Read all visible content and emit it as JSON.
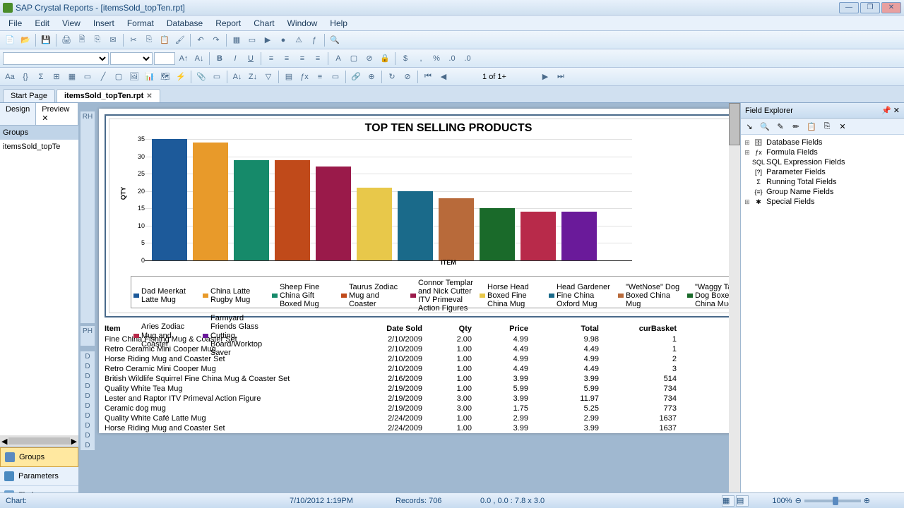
{
  "title": "SAP Crystal Reports - [itemsSold_topTen.rpt]",
  "menu": [
    "File",
    "Edit",
    "View",
    "Insert",
    "Format",
    "Database",
    "Report",
    "Chart",
    "Window",
    "Help"
  ],
  "nav": {
    "page_indicator": "1 of 1+"
  },
  "tabs": {
    "start": "Start Page",
    "doc": "itemsSold_topTen.rpt"
  },
  "subtabs": {
    "design": "Design",
    "preview": "Preview"
  },
  "left": {
    "groups_hdr": "Groups",
    "tree_root": "itemsSold_topTe",
    "btn_groups": "Groups",
    "btn_params": "Parameters",
    "btn_find": "Find"
  },
  "sections": {
    "rh": "RH",
    "ph": "PH",
    "d": "D"
  },
  "right": {
    "title": "Field Explorer",
    "items": [
      "Database Fields",
      "Formula Fields",
      "SQL Expression Fields",
      "Parameter Fields",
      "Running Total Fields",
      "Group Name Fields",
      "Special Fields"
    ]
  },
  "chart_data": {
    "type": "bar",
    "title": "TOP TEN SELLING PRODUCTS",
    "ylabel": "QTY",
    "xlabel": "ITEM",
    "ylim": [
      0,
      35
    ],
    "yticks": [
      0,
      5,
      10,
      15,
      20,
      25,
      30,
      35
    ],
    "series": [
      {
        "name": "Dad Meerkat Latte Mug",
        "value": 35,
        "color": "#1d5a9a"
      },
      {
        "name": "China Latte Rugby Mug",
        "value": 34,
        "color": "#e89a2a"
      },
      {
        "name": "Sheep Fine China Gift Boxed Mug",
        "value": 29,
        "color": "#168a6a"
      },
      {
        "name": "Taurus Zodiac Mug and Coaster",
        "value": 29,
        "color": "#c04a1a"
      },
      {
        "name": "Connor Templar and Nick Cutter ITV Primeval Action Figures",
        "value": 27,
        "color": "#9a1a4a"
      },
      {
        "name": "Horse Head Boxed Fine China Mug",
        "value": 21,
        "color": "#e8c84a"
      },
      {
        "name": "Head Gardener Fine China Oxford Mug",
        "value": 20,
        "color": "#1a6a8a"
      },
      {
        "name": "\"WetNose\" Dog Boxed China Mug",
        "value": 18,
        "color": "#b86a3a"
      },
      {
        "name": "\"Waggy Tail\" Dog Boxed China Mug",
        "value": 15,
        "color": "#1a6a2a"
      },
      {
        "name": "Aries Zodiac Mug and Coaster",
        "value": 14,
        "color": "#b82a4a"
      },
      {
        "name": "Farmyard Friends Glass Cutting Board/Worktop Saver",
        "value": 14,
        "color": "#6a1a9a"
      }
    ]
  },
  "table": {
    "headers": {
      "item": "Item",
      "date": "Date Sold",
      "qty": "Qty",
      "price": "Price",
      "total": "Total",
      "basket": "curBasket"
    },
    "rows": [
      {
        "item": "Fine China Fishing Mug & Coaster Set",
        "date": "2/10/2009",
        "qty": "2.00",
        "price": "4.99",
        "total": "9.98",
        "basket": "1"
      },
      {
        "item": "Retro Ceramic Mini Cooper Mug",
        "date": "2/10/2009",
        "qty": "1.00",
        "price": "4.49",
        "total": "4.49",
        "basket": "1"
      },
      {
        "item": "Horse Riding Mug and Coaster Set",
        "date": "2/10/2009",
        "qty": "1.00",
        "price": "4.99",
        "total": "4.99",
        "basket": "2"
      },
      {
        "item": "Retro Ceramic Mini Cooper Mug",
        "date": "2/10/2009",
        "qty": "1.00",
        "price": "4.49",
        "total": "4.49",
        "basket": "3"
      },
      {
        "item": "British Wildlife Squirrel Fine China Mug & Coaster Set",
        "date": "2/16/2009",
        "qty": "1.00",
        "price": "3.99",
        "total": "3.99",
        "basket": "514"
      },
      {
        "item": "Quality White Tea Mug",
        "date": "2/19/2009",
        "qty": "1.00",
        "price": "5.99",
        "total": "5.99",
        "basket": "734"
      },
      {
        "item": "Lester and Raptor  ITV Primeval Action Figure",
        "date": "2/19/2009",
        "qty": "3.00",
        "price": "3.99",
        "total": "11.97",
        "basket": "734"
      },
      {
        "item": "Ceramic dog mug",
        "date": "2/19/2009",
        "qty": "3.00",
        "price": "1.75",
        "total": "5.25",
        "basket": "773"
      },
      {
        "item": "Quality White Café Latte Mug",
        "date": "2/24/2009",
        "qty": "1.00",
        "price": "2.99",
        "total": "2.99",
        "basket": "1637"
      },
      {
        "item": "Horse Riding Mug and Coaster Set",
        "date": "2/24/2009",
        "qty": "1.00",
        "price": "3.99",
        "total": "3.99",
        "basket": "1637"
      }
    ]
  },
  "status": {
    "left": "Chart:",
    "datetime": "7/10/2012   1:19PM",
    "records": "Records: 706",
    "coords": "0.0 , 0.0 : 7.8 x 3.0",
    "zoom": "100%"
  }
}
